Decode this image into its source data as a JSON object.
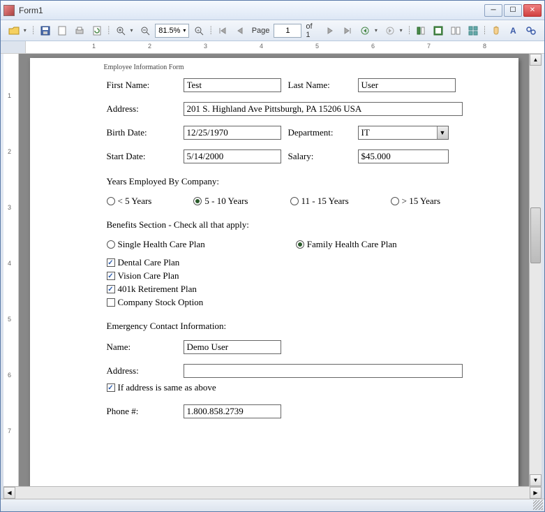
{
  "window": {
    "title": "Form1"
  },
  "toolbar": {
    "zoom_pct": "81.5%",
    "page_label": "Page",
    "page_current": "1",
    "page_of": "of 1"
  },
  "ruler": {
    "h": [
      "1",
      "2",
      "3",
      "4",
      "5",
      "6",
      "7",
      "8"
    ],
    "v": [
      "1",
      "2",
      "3",
      "4",
      "5",
      "6",
      "7"
    ]
  },
  "form": {
    "title": "Employee Information Form",
    "first_name": {
      "label": "First Name:",
      "value": "Test"
    },
    "last_name": {
      "label": "Last Name:",
      "value": "User"
    },
    "address": {
      "label": "Address:",
      "value": "201 S. Highland Ave Pittsburgh, PA 15206 USA"
    },
    "birth_date": {
      "label": "Birth Date:",
      "value": "12/25/1970"
    },
    "department": {
      "label": "Department:",
      "value": "IT"
    },
    "start_date": {
      "label": "Start Date:",
      "value": "5/14/2000"
    },
    "salary": {
      "label": "Salary:",
      "value": "$45.000"
    },
    "years_section": "Years Employed By Company:",
    "years_options": [
      {
        "label": "< 5 Years",
        "checked": false
      },
      {
        "label": "5 - 10 Years",
        "checked": true
      },
      {
        "label": "11 - 15 Years",
        "checked": false
      },
      {
        "label": "> 15 Years",
        "checked": false
      }
    ],
    "benefits_section": "Benefits Section - Check all that apply:",
    "health_options": [
      {
        "label": "Single Health Care Plan",
        "checked": false
      },
      {
        "label": "Family Health Care Plan",
        "checked": true
      }
    ],
    "benefit_checks": [
      {
        "label": "Dental Care Plan",
        "checked": true
      },
      {
        "label": "Vision Care Plan",
        "checked": true
      },
      {
        "label": "401k Retirement Plan",
        "checked": true
      },
      {
        "label": "Company Stock Option",
        "checked": false
      }
    ],
    "emergency_section": "Emergency Contact Information:",
    "ec_name": {
      "label": "Name:",
      "value": "Demo User"
    },
    "ec_address": {
      "label": "Address:",
      "value": ""
    },
    "ec_same": {
      "label": "If address is same as above",
      "checked": true
    },
    "ec_phone": {
      "label": "Phone #:",
      "value": "1.800.858.2739"
    }
  }
}
